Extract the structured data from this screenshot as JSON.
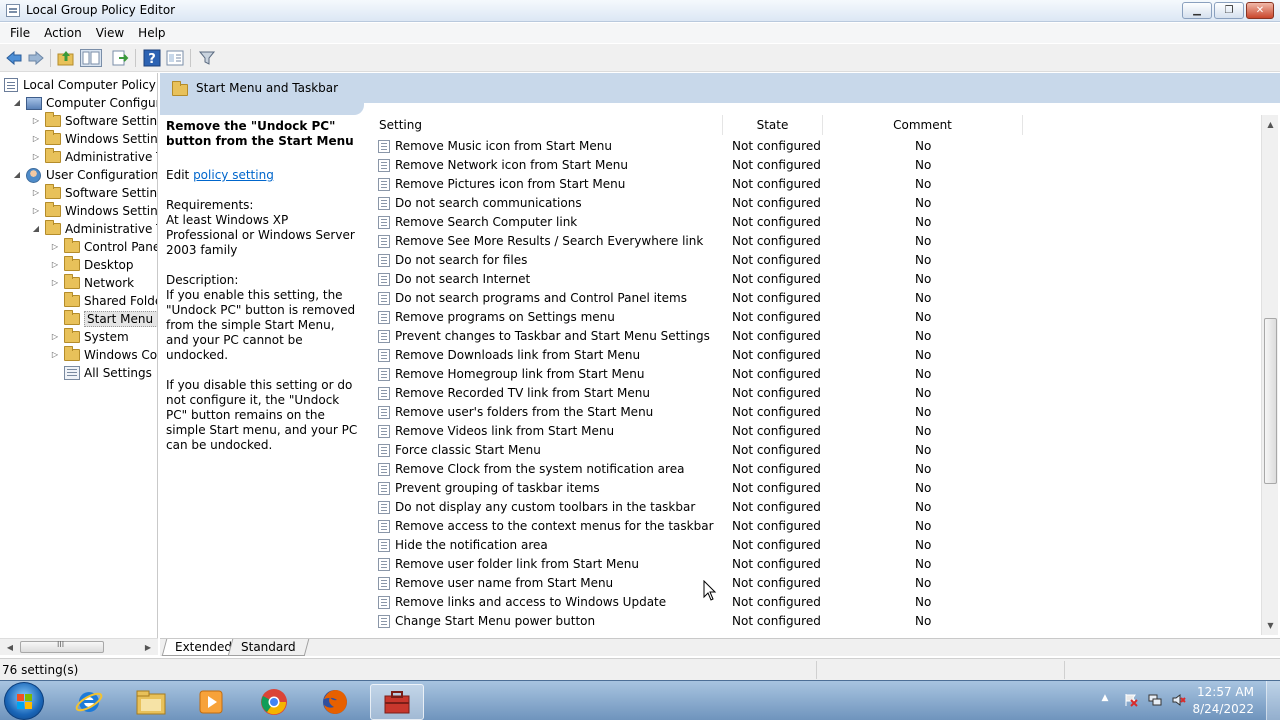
{
  "window": {
    "title": "Local Group Policy Editor",
    "minimize_glyph": "▁",
    "maximize_glyph": "❐",
    "close_glyph": "✕"
  },
  "menu": {
    "items": [
      "File",
      "Action",
      "View",
      "Help"
    ]
  },
  "toolbar": {
    "icons": [
      "back-arrow-icon",
      "forward-arrow-icon",
      "up-folder-icon",
      "show-hide-tree-icon",
      "export-list-icon",
      "help-icon",
      "extended-view-icon",
      "filter-icon"
    ]
  },
  "tree": {
    "items": [
      {
        "label": "Local Computer Policy",
        "icon": "policy",
        "toggle": ""
      },
      {
        "label": "Computer Configura",
        "icon": "computer",
        "toggle": "◢"
      },
      {
        "label": "Software Settings",
        "icon": "folder",
        "toggle": "▷"
      },
      {
        "label": "Windows Setting",
        "icon": "folder",
        "toggle": "▷"
      },
      {
        "label": "Administrative Te",
        "icon": "folder",
        "toggle": "▷"
      },
      {
        "label": "User Configuration",
        "icon": "user",
        "toggle": "◢"
      },
      {
        "label": "Software Settings",
        "icon": "folder",
        "toggle": "▷"
      },
      {
        "label": "Windows Setting",
        "icon": "folder",
        "toggle": "▷"
      },
      {
        "label": "Administrative Te",
        "icon": "folder",
        "toggle": "◢"
      },
      {
        "label": "Control Panel",
        "icon": "folder",
        "toggle": "▷"
      },
      {
        "label": "Desktop",
        "icon": "folder",
        "toggle": "▷"
      },
      {
        "label": "Network",
        "icon": "folder",
        "toggle": "▷"
      },
      {
        "label": "Shared Folder",
        "icon": "folder",
        "toggle": ""
      },
      {
        "label": "Start Menu ar",
        "icon": "folder",
        "toggle": "",
        "selected": true
      },
      {
        "label": "System",
        "icon": "folder",
        "toggle": "▷"
      },
      {
        "label": "Windows Cor",
        "icon": "folder",
        "toggle": "▷"
      },
      {
        "label": "All Settings",
        "icon": "allsettings",
        "toggle": ""
      }
    ],
    "hscroll_left": "◀",
    "hscroll_right": "▶",
    "hscroll_grip": "III"
  },
  "pane": {
    "title": "Start Menu and Taskbar"
  },
  "description": {
    "title": "Remove the \"Undock PC\" button from the Start Menu",
    "edit_prefix": "Edit ",
    "edit_link": "policy setting",
    "requirements_label": "Requirements:",
    "requirements_text": "At least Windows XP Professional or Windows Server 2003 family",
    "description_label": "Description:",
    "description_enable": "If you enable this setting, the \"Undock PC\" button is removed from the simple Start Menu, and your PC cannot be undocked.",
    "description_disable": "If you disable this setting or do not configure it, the \"Undock PC\" button remains on the simple Start menu, and your PC can be undocked."
  },
  "columns": {
    "setting": "Setting",
    "state": "State",
    "comment": "Comment"
  },
  "rows": [
    {
      "setting": "Remove Music icon from Start Menu",
      "state": "Not configured",
      "comment": "No"
    },
    {
      "setting": "Remove Network icon from Start Menu",
      "state": "Not configured",
      "comment": "No"
    },
    {
      "setting": "Remove Pictures icon from Start Menu",
      "state": "Not configured",
      "comment": "No"
    },
    {
      "setting": "Do not search communications",
      "state": "Not configured",
      "comment": "No"
    },
    {
      "setting": "Remove Search Computer link",
      "state": "Not configured",
      "comment": "No"
    },
    {
      "setting": "Remove See More Results / Search Everywhere link",
      "state": "Not configured",
      "comment": "No"
    },
    {
      "setting": "Do not search for files",
      "state": "Not configured",
      "comment": "No"
    },
    {
      "setting": "Do not search Internet",
      "state": "Not configured",
      "comment": "No"
    },
    {
      "setting": "Do not search programs and Control Panel items",
      "state": "Not configured",
      "comment": "No"
    },
    {
      "setting": "Remove programs on Settings menu",
      "state": "Not configured",
      "comment": "No"
    },
    {
      "setting": "Prevent changes to Taskbar and Start Menu Settings",
      "state": "Not configured",
      "comment": "No"
    },
    {
      "setting": "Remove Downloads link from Start Menu",
      "state": "Not configured",
      "comment": "No"
    },
    {
      "setting": "Remove Homegroup link from Start Menu",
      "state": "Not configured",
      "comment": "No"
    },
    {
      "setting": "Remove Recorded TV link from Start Menu",
      "state": "Not configured",
      "comment": "No"
    },
    {
      "setting": "Remove user's folders from the Start Menu",
      "state": "Not configured",
      "comment": "No"
    },
    {
      "setting": "Remove Videos link from Start Menu",
      "state": "Not configured",
      "comment": "No"
    },
    {
      "setting": "Force classic Start Menu",
      "state": "Not configured",
      "comment": "No"
    },
    {
      "setting": "Remove Clock from the system notification area",
      "state": "Not configured",
      "comment": "No"
    },
    {
      "setting": "Prevent grouping of taskbar items",
      "state": "Not configured",
      "comment": "No"
    },
    {
      "setting": "Do not display any custom toolbars in the taskbar",
      "state": "Not configured",
      "comment": "No"
    },
    {
      "setting": "Remove access to the context menus for the taskbar",
      "state": "Not configured",
      "comment": "No"
    },
    {
      "setting": "Hide the notification area",
      "state": "Not configured",
      "comment": "No"
    },
    {
      "setting": "Remove user folder link from Start Menu",
      "state": "Not configured",
      "comment": "No"
    },
    {
      "setting": "Remove user name from Start Menu",
      "state": "Not configured",
      "comment": "No"
    },
    {
      "setting": "Remove links and access to Windows Update",
      "state": "Not configured",
      "comment": "No"
    },
    {
      "setting": "Change Start Menu power button",
      "state": "Not configured",
      "comment": "No"
    }
  ],
  "vscroll": {
    "up": "▲",
    "down": "▼",
    "thumb_position": 0.35
  },
  "tabs": {
    "extended": "Extended",
    "standard": "Standard"
  },
  "status": {
    "text": "76 setting(s)"
  },
  "taskbar": {
    "apps": [
      "internet-explorer-icon",
      "file-explorer-icon",
      "media-player-icon",
      "chrome-icon",
      "firefox-icon",
      "group-policy-icon"
    ],
    "time": "12:57 AM",
    "date": "8/24/2022",
    "tray_icons": [
      "show-hidden-icons-arrow",
      "action-center-flag-icon",
      "network-icon",
      "volume-muted-icon"
    ],
    "tray_arrow": "▲"
  },
  "colors": {
    "pane_header": "#c8d8ea",
    "link": "#0066cc",
    "taskbar_top": "#a8c4e0",
    "taskbar_bottom": "#6f94bd"
  }
}
